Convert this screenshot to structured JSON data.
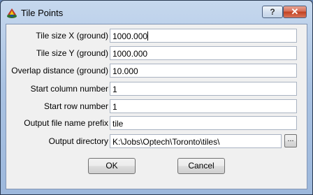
{
  "window": {
    "title": "Tile Points",
    "help_label": "?",
    "close_label": "✕"
  },
  "form": {
    "tile_size_x_label": "Tile size X (ground)",
    "tile_size_x_value": "1000.000",
    "tile_size_y_label": "Tile size Y (ground)",
    "tile_size_y_value": "1000.000",
    "overlap_label": "Overlap distance (ground)",
    "overlap_value": "10.000",
    "start_column_label": "Start column number",
    "start_column_value": "1",
    "start_row_label": "Start row number",
    "start_row_value": "1",
    "prefix_label": "Output file name prefix",
    "prefix_value": "tile",
    "output_dir_label": "Output directory",
    "output_dir_value": "K:\\Jobs\\Optech\\Toronto\\tiles\\",
    "browse_label": "..."
  },
  "buttons": {
    "ok_label": "OK",
    "cancel_label": "Cancel"
  },
  "icons": {
    "app": "tile-points-app-icon"
  }
}
